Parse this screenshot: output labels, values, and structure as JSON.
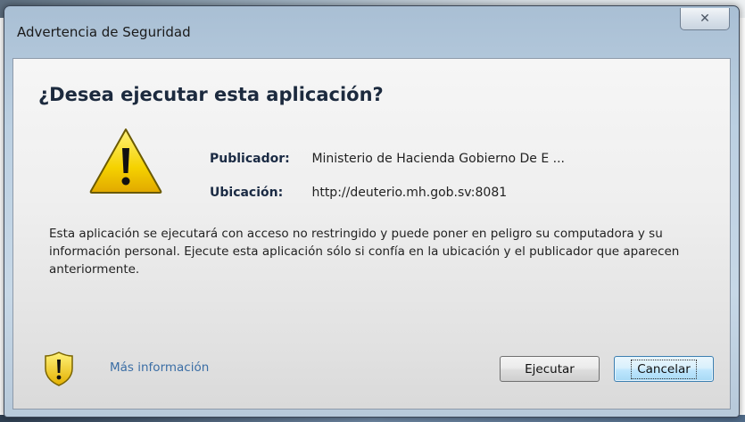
{
  "window": {
    "title": "Advertencia de Seguridad",
    "close_glyph": "✕"
  },
  "dialog": {
    "heading": "¿Desea ejecutar esta aplicación?",
    "publisher_label": "Publicador:",
    "publisher_value": "Ministerio de Hacienda Gobierno De E ...",
    "location_label": "Ubicación:",
    "location_value": "http://deuterio.mh.gob.sv:8081",
    "description": "Esta aplicación se ejecutará con acceso no restringido y puede poner en peligro su computadora y su información personal. Ejecute esta aplicación sólo si confía en la ubicación y el publicador que aparecen anteriormente.",
    "more_info": "Más información",
    "warning_icon": "warning-triangle-icon",
    "shield_icon": "shield-warning-icon"
  },
  "buttons": {
    "run_label": "Ejecutar",
    "cancel_label": "Cancelar"
  },
  "colors": {
    "heading": "#1c2a3e",
    "link": "#3b6ea5",
    "warning_yellow": "#f5d200"
  }
}
